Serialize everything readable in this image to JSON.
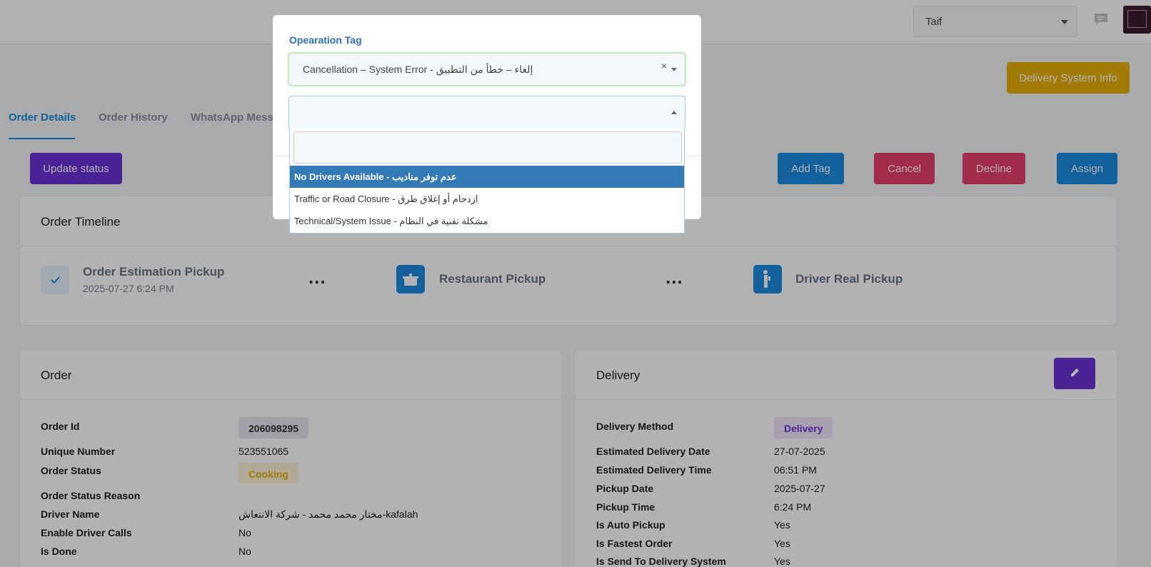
{
  "header": {
    "city_select_value": "Taif"
  },
  "actions": {
    "delivery_system_info": "Delivery System Info",
    "update_status": "Update status",
    "add_tag": "Add Tag",
    "cancel": "Cancel",
    "decline": "Decline",
    "assign": "Assign"
  },
  "tabs": [
    {
      "label": "Order Details"
    },
    {
      "label": "Order History"
    },
    {
      "label": "WhatsApp Mess"
    }
  ],
  "timeline": {
    "title": "Order Timeline",
    "steps": [
      {
        "label": "Order Estimation Pickup",
        "date": "2025-07-27 6:24 PM",
        "icon": "check-icon"
      },
      {
        "label": "Restaurant Pickup",
        "icon": "cooking-pot-icon"
      },
      {
        "label": "Driver Real Pickup",
        "icon": "driver-icon"
      }
    ],
    "separator": "..."
  },
  "order": {
    "title": "Order",
    "order_id_label": "Order Id",
    "order_id": "206098295",
    "unique_number_label": "Unique Number",
    "unique_number": "523551065",
    "order_status_label": "Order Status",
    "order_status": "Cooking",
    "order_status_reason_label": "Order Status Reason",
    "driver_name_label": "Driver Name",
    "driver_name": "مختار محمد محمد - شركة الانتعاش-kafalah",
    "enable_driver_calls_label": "Enable Driver Calls",
    "enable_driver_calls": "No",
    "is_done_label": "Is Done",
    "is_done": "No"
  },
  "delivery": {
    "title": "Delivery",
    "method_label": "Delivery Method",
    "method": "Delivery",
    "est_date_label": "Estimated Delivery Date",
    "est_date": "27-07-2025",
    "est_time_label": "Estimated Delivery Time",
    "est_time": "06:51 PM",
    "pickup_date_label": "Pickup Date",
    "pickup_date": "2025-07-27",
    "pickup_time_label": "Pickup Time",
    "pickup_time": "6:24 PM",
    "auto_pickup_label": "Is Auto Pickup",
    "auto_pickup": "Yes",
    "fastest_label": "Is Fastest Order",
    "fastest": "Yes",
    "send_label": "Is Send To Delivery System",
    "send": "Yes"
  },
  "modal": {
    "label": "Opearation Tag",
    "selected_tag": "Cancellation – System Error - إلغاء – خطأ من التطبيق",
    "clear_symbol": "×",
    "search_value": "",
    "options": [
      {
        "label": "No Drivers Available - عدم توفر مناديب"
      },
      {
        "label": "Traffic or Road Closure - ازدحام أو إغلاق طرق"
      },
      {
        "label": "Technical/System Issue - مشكلة تقنية في النظام"
      }
    ]
  },
  "colors": {
    "primary_blue": "#1a8be0",
    "purple": "#6b33d9",
    "danger": "#e83f6e",
    "warning": "#e8b10a",
    "highlight": "#337ab7"
  }
}
